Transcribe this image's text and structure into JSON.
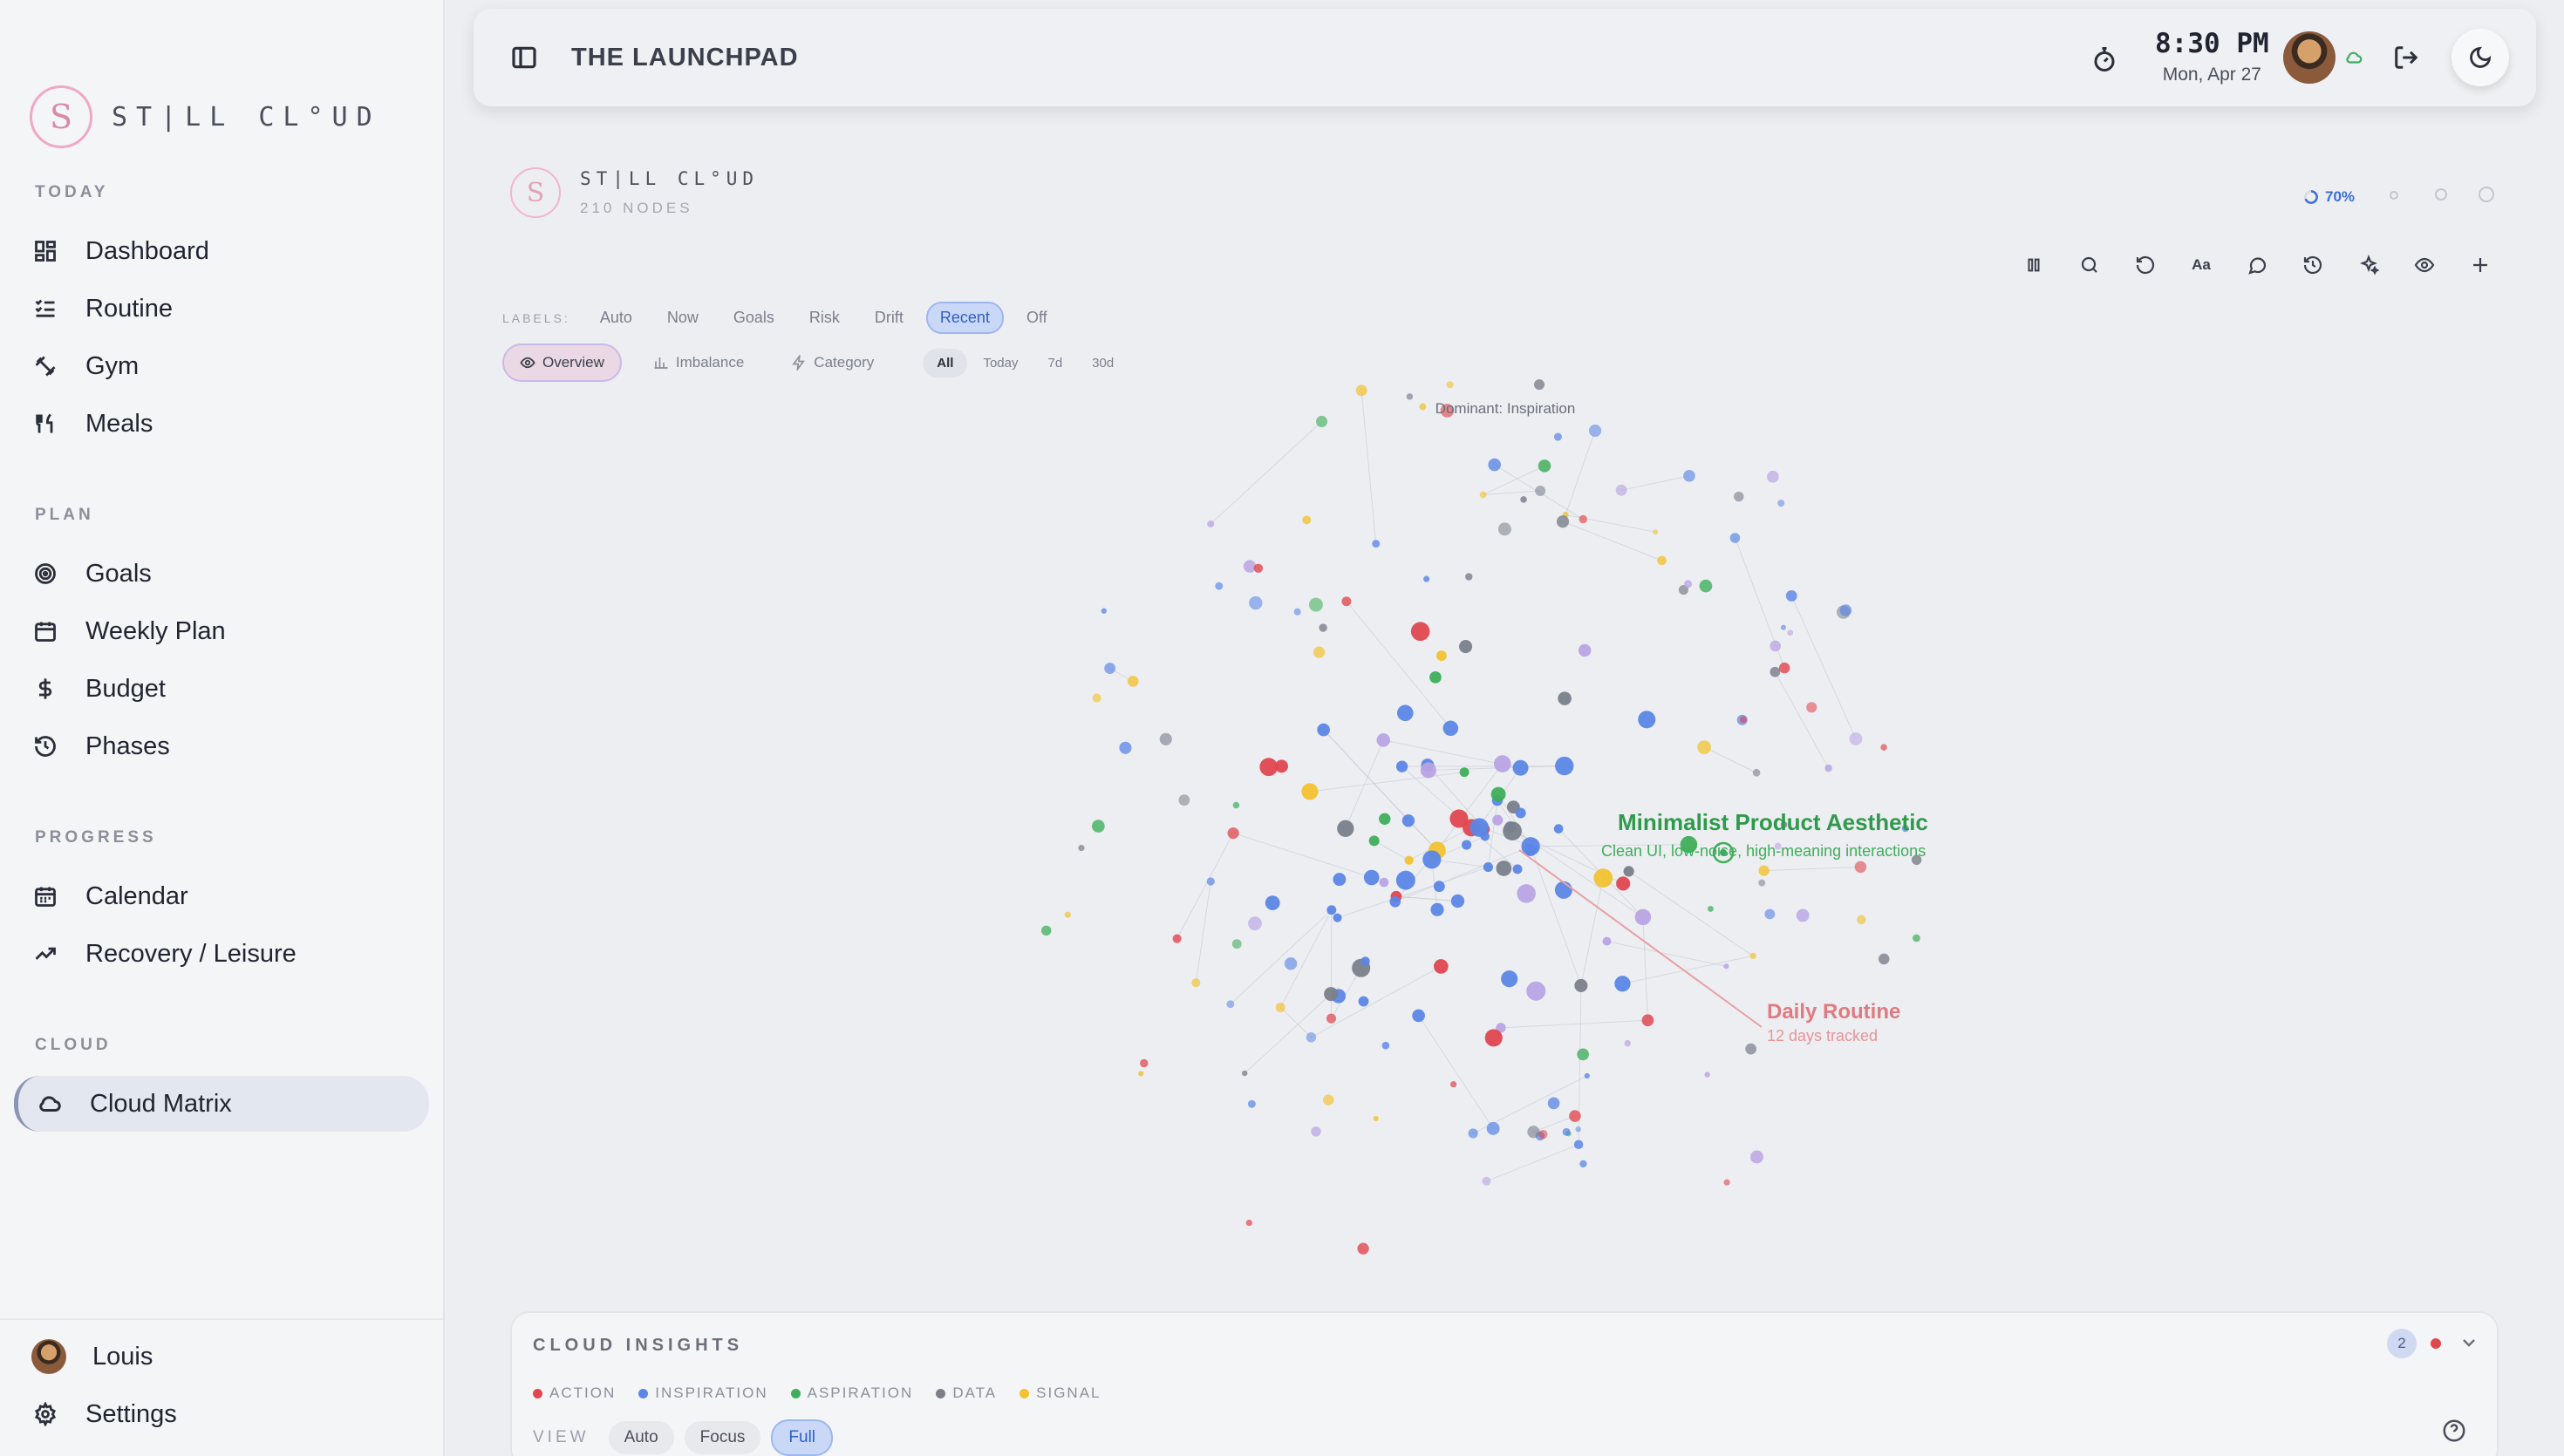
{
  "sidebar": {
    "brand": "ST|LL CL°UD",
    "sections": [
      {
        "title": "TODAY",
        "items": [
          {
            "label": "Dashboard",
            "icon": "dashboard-icon"
          },
          {
            "label": "Routine",
            "icon": "checklist-icon"
          },
          {
            "label": "Gym",
            "icon": "dumbbell-icon"
          },
          {
            "label": "Meals",
            "icon": "utensils-icon"
          }
        ]
      },
      {
        "title": "PLAN",
        "items": [
          {
            "label": "Goals",
            "icon": "target-icon"
          },
          {
            "label": "Weekly Plan",
            "icon": "calendar-icon"
          },
          {
            "label": "Budget",
            "icon": "dollar-icon"
          },
          {
            "label": "Phases",
            "icon": "history-icon"
          }
        ]
      },
      {
        "title": "PROGRESS",
        "items": [
          {
            "label": "Calendar",
            "icon": "calendar-grid-icon"
          },
          {
            "label": "Recovery / Leisure",
            "icon": "trending-up-icon"
          }
        ]
      },
      {
        "title": "CLOUD",
        "items": [
          {
            "label": "Cloud Matrix",
            "icon": "cloud-icon",
            "active": true
          }
        ]
      }
    ],
    "user": "Louis",
    "settings": "Settings"
  },
  "topbar": {
    "title": "THE LAUNCHPAD",
    "time": "8:30 PM",
    "date": "Mon, Apr 27"
  },
  "matrix": {
    "brand": "ST|LL CL°UD",
    "node_count": "210 NODES",
    "progress": "70%",
    "labels_heading": "LABELS:",
    "labels": [
      "Auto",
      "Now",
      "Goals",
      "Risk",
      "Drift",
      "Recent",
      "Off"
    ],
    "labels_active": "Recent",
    "views": [
      "Overview",
      "Imbalance",
      "Category"
    ],
    "views_active": "Overview",
    "ranges": [
      "All",
      "Today",
      "7d",
      "30d"
    ],
    "ranges_active": "All",
    "dominant": "Dominant: Inspiration",
    "highlight_title": "Minimalist Product Aesthetic",
    "highlight_sub": "Clean UI, low-noise, high-meaning interactions",
    "secondary_title": "Daily Routine",
    "secondary_sub": "12 days tracked"
  },
  "insights": {
    "title": "CLOUD INSIGHTS",
    "count": "2",
    "legend": [
      {
        "label": "ACTION",
        "color": "#e0474f"
      },
      {
        "label": "INSPIRATION",
        "color": "#5b86e5"
      },
      {
        "label": "ASPIRATION",
        "color": "#3fae5a"
      },
      {
        "label": "DATA",
        "color": "#7a7f8a"
      },
      {
        "label": "SIGNAL",
        "color": "#f2c230"
      }
    ],
    "view_heading": "VIEW",
    "view_options": [
      "Auto",
      "Focus",
      "Full"
    ],
    "view_active": "Full"
  },
  "colors": {
    "action": "#e0474f",
    "inspiration": "#5b86e5",
    "aspiration": "#3fae5a",
    "data": "#7a7f8a",
    "signal": "#f2c230",
    "accent": "#3b6fd8"
  }
}
